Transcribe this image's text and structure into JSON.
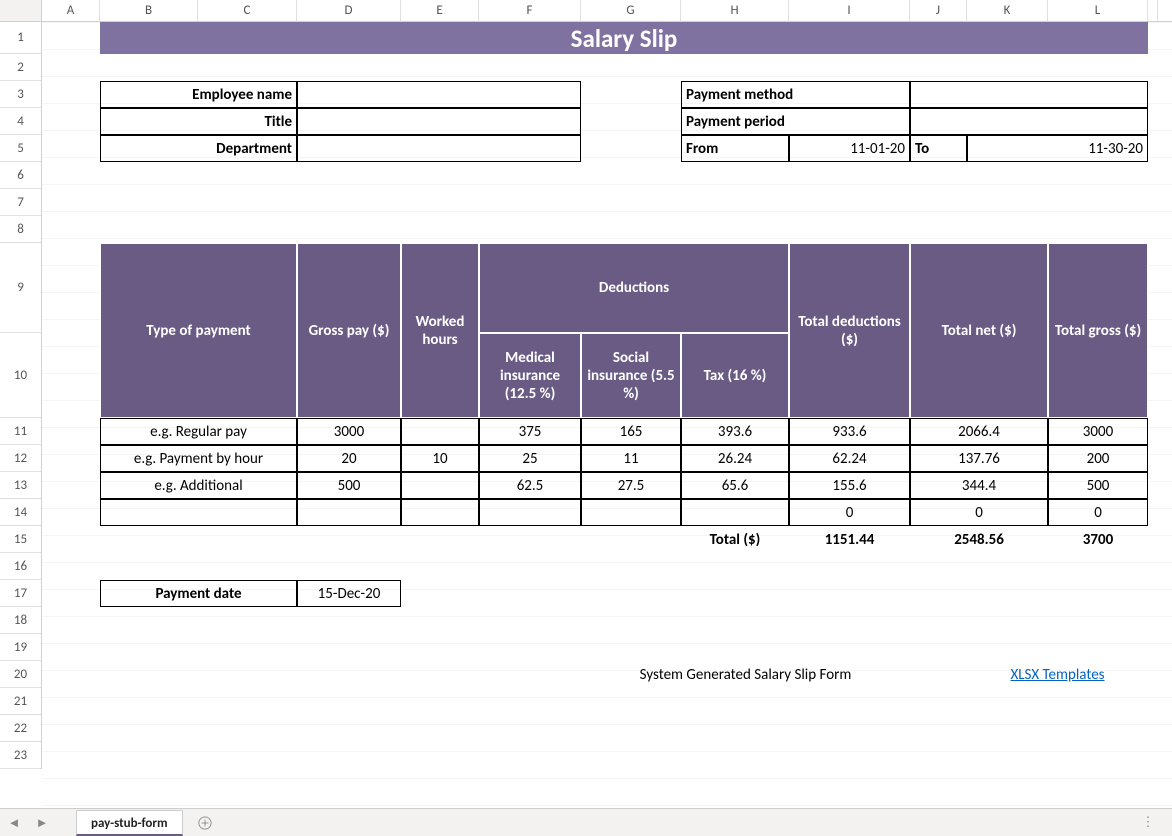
{
  "columns": [
    "A",
    "B",
    "C",
    "D",
    "E",
    "F",
    "G",
    "H",
    "I",
    "J",
    "K",
    "L"
  ],
  "col_widths": {
    "A": 58,
    "B": 98,
    "C": 99,
    "D": 104,
    "E": 78,
    "F": 102,
    "G": 100,
    "H": 108,
    "I": 121,
    "J": 57,
    "K": 81,
    "L": 100
  },
  "rows": [
    1,
    2,
    3,
    4,
    5,
    6,
    7,
    8,
    9,
    10,
    11,
    12,
    13,
    14,
    15,
    16,
    17,
    18,
    19,
    20,
    21,
    22,
    23
  ],
  "row_heights": {
    "1": 32,
    "2": 27,
    "3": 27,
    "4": 27,
    "5": 27,
    "6": 27,
    "7": 27,
    "8": 27,
    "9": 90,
    "10": 85,
    "11": 27,
    "12": 27,
    "13": 27,
    "14": 27,
    "15": 27,
    "16": 27,
    "17": 27,
    "18": 27,
    "19": 27,
    "20": 27,
    "21": 27,
    "22": 27,
    "23": 27
  },
  "title": "Salary Slip",
  "info": {
    "emp_name_label": "Employee name",
    "title_label": "Title",
    "dept_label": "Department",
    "pay_method_label": "Payment method",
    "pay_period_label": "Payment period",
    "from_label": "From",
    "to_label": "To",
    "from_value": "11-01-20",
    "to_value": "11-30-20"
  },
  "table": {
    "headers": {
      "type": "Type of payment",
      "gross": "Gross pay ($)",
      "worked": "Worked hours",
      "deductions": "Deductions",
      "medical": "Medical insurance (12.5 %)",
      "social": "Social insurance (5.5 %)",
      "tax": "Tax (16 %)",
      "total_ded": "Total deductions ($)",
      "total_net": "Total net ($)",
      "total_gross": "Total gross ($)"
    },
    "rows": [
      {
        "type": "e.g. Regular pay",
        "gross": "3000",
        "worked": "",
        "med": "375",
        "soc": "165",
        "tax": "393.6",
        "td": "933.6",
        "net": "2066.4",
        "tg": "3000"
      },
      {
        "type": "e.g. Payment by hour",
        "gross": "20",
        "worked": "10",
        "med": "25",
        "soc": "11",
        "tax": "26.24",
        "td": "62.24",
        "net": "137.76",
        "tg": "200"
      },
      {
        "type": "e.g. Additional",
        "gross": "500",
        "worked": "",
        "med": "62.5",
        "soc": "27.5",
        "tax": "65.6",
        "td": "155.6",
        "net": "344.4",
        "tg": "500"
      },
      {
        "type": "",
        "gross": "",
        "worked": "",
        "med": "",
        "soc": "",
        "tax": "",
        "td": "0",
        "net": "0",
        "tg": "0"
      }
    ],
    "total_label": "Total ($)",
    "totals": {
      "td": "1151.44",
      "net": "2548.56",
      "tg": "3700"
    }
  },
  "payment_date_label": "Payment date",
  "payment_date_value": "15-Dec-20",
  "footer_note": "System Generated Salary Slip Form",
  "footer_link": "XLSX Templates",
  "sheet_tab": "pay-stub-form"
}
